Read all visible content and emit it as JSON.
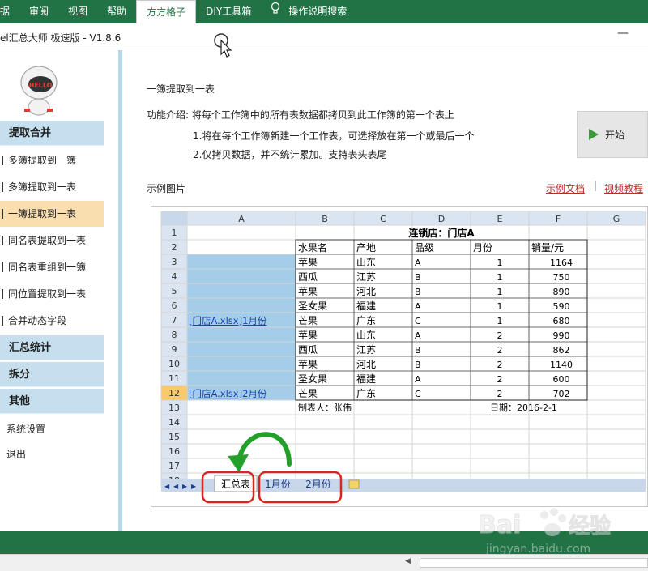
{
  "ribbon": {
    "tabs": [
      "据",
      "审阅",
      "视图",
      "帮助",
      "方方格子",
      "DIY工具箱",
      "操作说明搜索"
    ],
    "active_tab": "方方格子",
    "bulb_icon": "lightbulb-icon"
  },
  "window": {
    "title": "el汇总大师 极速版 - V1.8.6",
    "minimize": "—"
  },
  "sidebar": {
    "sections": {
      "extract": "提取合并",
      "summary": "汇总统计",
      "split": "拆分",
      "other": "其他"
    },
    "items": [
      "多簿提取到一簿",
      "多簿提取到一表",
      "一簿提取到一表",
      "同名表提取到一表",
      "同名表重组到一簿",
      "同位置提取到一表",
      "合并动态字段"
    ],
    "active_item": "一簿提取到一表",
    "other_items": [
      "系统设置",
      "退出"
    ]
  },
  "main": {
    "title": "一簿提取到一表",
    "intro": "功能介绍: 将每个工作簿中的所有表数据都拷贝到此工作簿的第一个表上",
    "point1": "1.将在每个工作簿新建一个工作表，可选择放在第一个或最后一个",
    "point2": "2.仅拷贝数据，并不统计累加。支持表头表尾",
    "start_button": "开始",
    "sample_label": "示例图片",
    "link_doc": "示例文档",
    "link_sep": "|",
    "link_video": "视频教程"
  },
  "sample_sheet": {
    "columns": [
      "A",
      "B",
      "C",
      "D",
      "E",
      "F",
      "G"
    ],
    "rows": [
      "1",
      "2",
      "3",
      "4",
      "5",
      "6",
      "7",
      "8",
      "9",
      "10",
      "11",
      "12",
      "13",
      "14",
      "15",
      "16",
      "17",
      "18"
    ],
    "table_title": "连锁店：门店A",
    "headers": [
      "水果名",
      "产地",
      "品级",
      "月份",
      "销量/元"
    ],
    "data": [
      [
        "苹果",
        "山东",
        "A",
        "1",
        "1164"
      ],
      [
        "西瓜",
        "江苏",
        "B",
        "1",
        "750"
      ],
      [
        "苹果",
        "河北",
        "B",
        "1",
        "890"
      ],
      [
        "圣女果",
        "福建",
        "A",
        "1",
        "590"
      ],
      [
        "芒果",
        "广东",
        "C",
        "1",
        "680"
      ],
      [
        "苹果",
        "山东",
        "A",
        "2",
        "990"
      ],
      [
        "西瓜",
        "江苏",
        "B",
        "2",
        "862"
      ],
      [
        "苹果",
        "河北",
        "B",
        "2",
        "1140"
      ],
      [
        "圣女果",
        "福建",
        "A",
        "2",
        "600"
      ],
      [
        "芒果",
        "广东",
        "C",
        "2",
        "702"
      ]
    ],
    "source_links": [
      "[门店A.xlsx]1月份",
      "[门店A.xlsx]2月份"
    ],
    "footer_maker": "制表人：张伟",
    "footer_date": "日期：2016-2-1",
    "sheet_tabs": [
      "汇总表",
      "1月份",
      "2月份"
    ]
  },
  "watermark": {
    "brand": "Bai",
    "brand2": "经验",
    "url": "jingyan.baidu.com"
  },
  "colors": {
    "ribbon_green": "#217346",
    "sidebar_section": "#c5dfef",
    "active_item": "#f9dfb0",
    "link_red": "#b5312b",
    "highlight_blue": "#a3cde8",
    "arrow_green": "#22a02a",
    "circle_red": "#d8261e"
  }
}
